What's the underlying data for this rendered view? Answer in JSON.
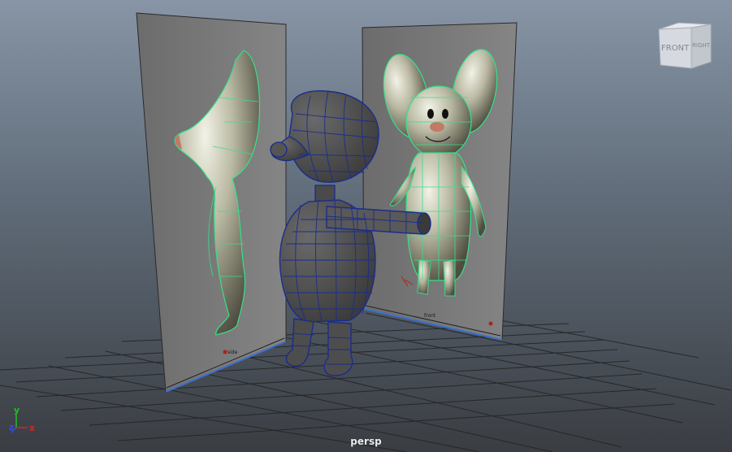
{
  "viewport": {
    "camera_label": "persp",
    "viewcube": {
      "front": "FRONT",
      "right": "RIGHT"
    },
    "axis": {
      "y": "y",
      "z": "z",
      "x": "x"
    }
  },
  "image_planes": {
    "side": {
      "label": "side"
    },
    "front": {
      "label": "front"
    }
  },
  "colors": {
    "mesh_wire": "#1b2c8c",
    "image_plane_wire": "#36e08a",
    "plane_border": "#3b6fd0",
    "axis_x": "#e02020",
    "axis_y": "#20c020",
    "axis_z": "#2050ff"
  }
}
